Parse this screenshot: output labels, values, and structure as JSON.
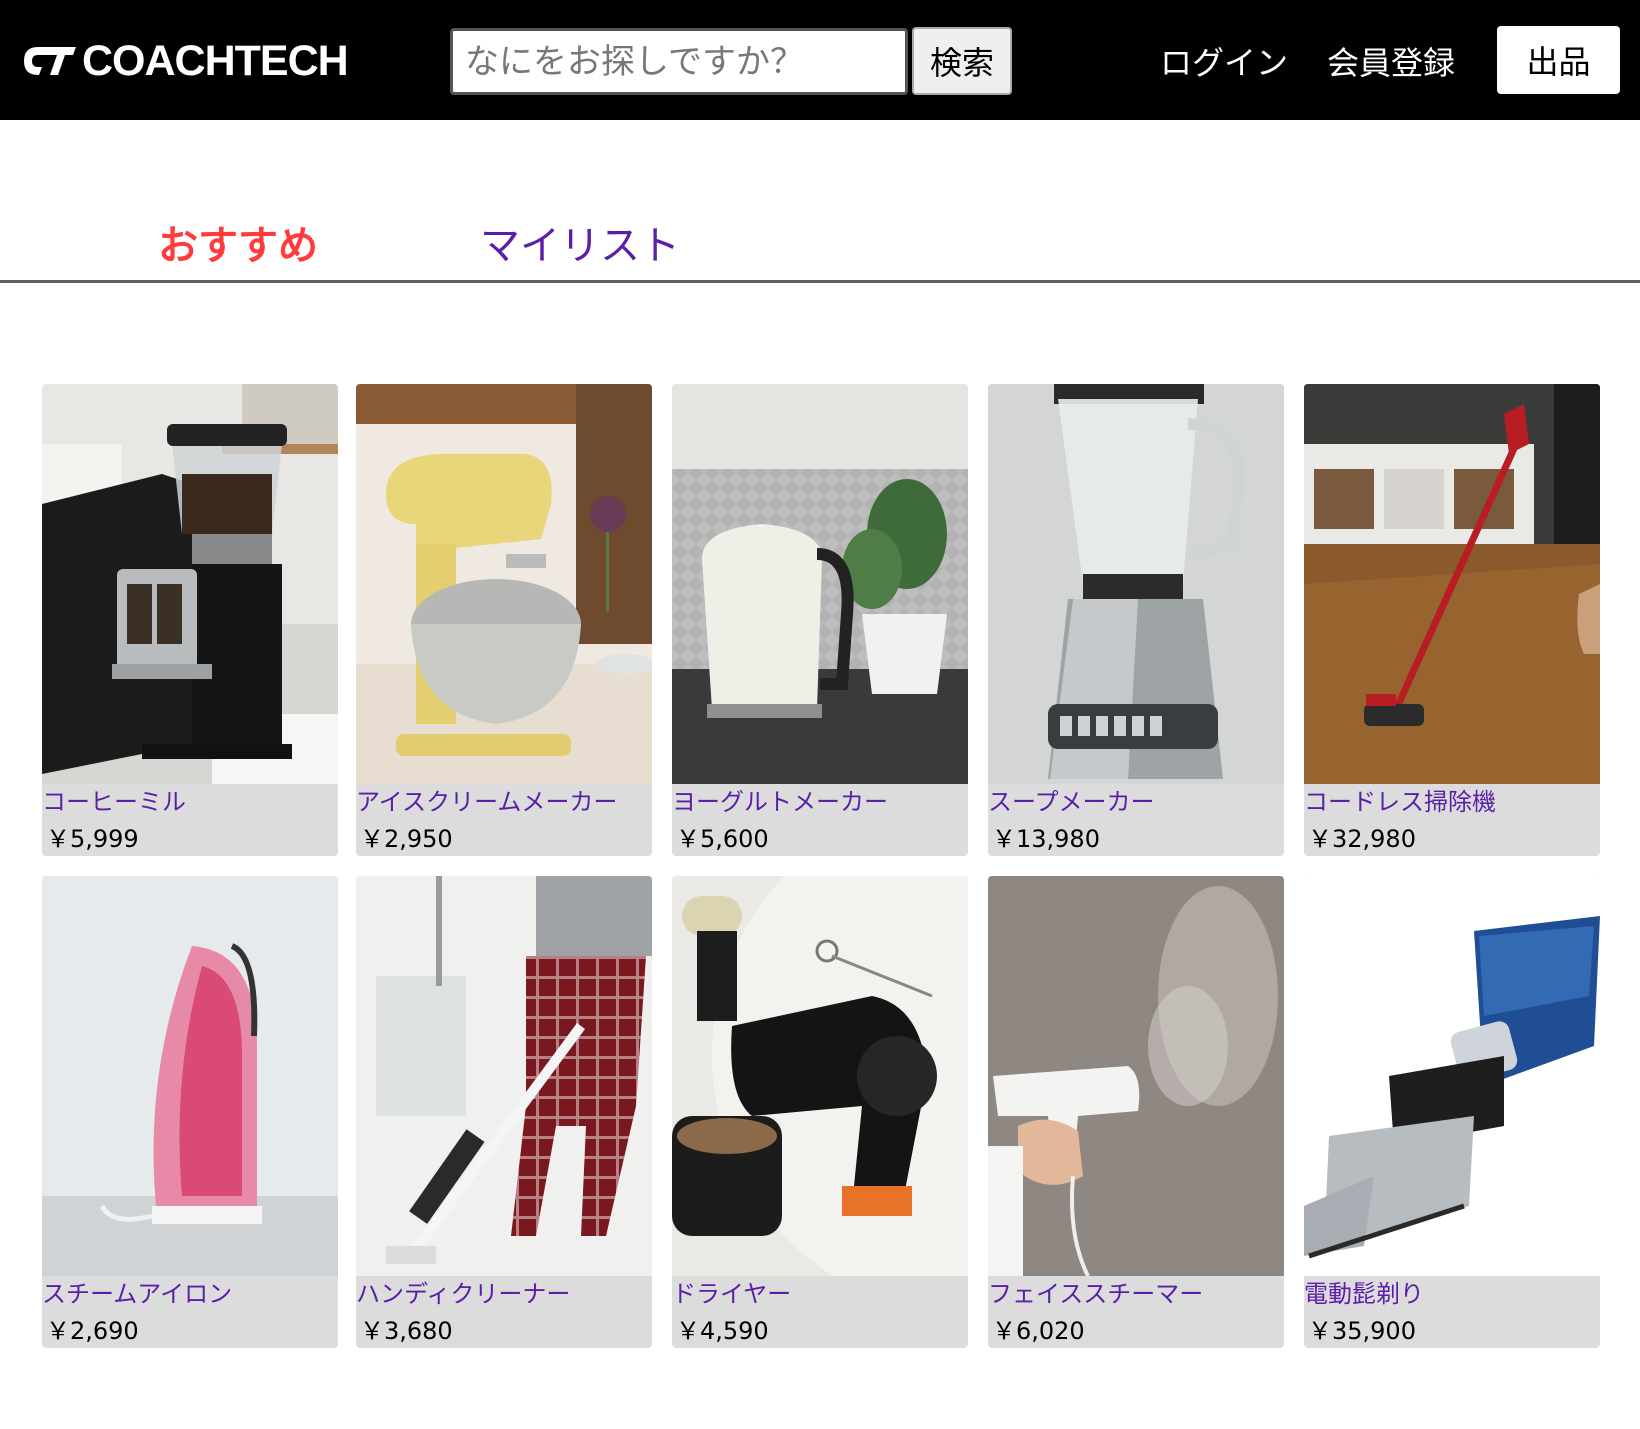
{
  "header": {
    "logo_text": "COACHTECH",
    "search_placeholder": "なにをお探しですか？",
    "search_button": "検索",
    "nav": {
      "login": "ログイン",
      "register": "会員登録",
      "sell": "出品"
    }
  },
  "tabs": {
    "recommend": "おすすめ",
    "mylist": "マイリスト",
    "active_color": "#ff3b3b",
    "inactive_color": "#5b1ea8"
  },
  "products": [
    {
      "name": "コーヒーミル",
      "price": "￥5,999",
      "image": "coffee-grinder"
    },
    {
      "name": "アイスクリームメーカー",
      "price": "￥2,950",
      "image": "stand-mixer"
    },
    {
      "name": "ヨーグルトメーカー",
      "price": "￥5,600",
      "image": "electric-kettle"
    },
    {
      "name": "スープメーカー",
      "price": "￥13,980",
      "image": "blender"
    },
    {
      "name": "コードレス掃除機",
      "price": "￥32,980",
      "image": "stick-vacuum"
    },
    {
      "name": "スチームアイロン",
      "price": "￥2,690",
      "image": "steam-iron"
    },
    {
      "name": "ハンディクリーナー",
      "price": "￥3,680",
      "image": "handheld-vacuum"
    },
    {
      "name": "ドライヤー",
      "price": "￥4,590",
      "image": "hair-dryer"
    },
    {
      "name": "フェイススチーマー",
      "price": "￥6,020",
      "image": "garment-steamer"
    },
    {
      "name": "電動髭剃り",
      "price": "￥35,900",
      "image": "hair-clipper"
    }
  ]
}
